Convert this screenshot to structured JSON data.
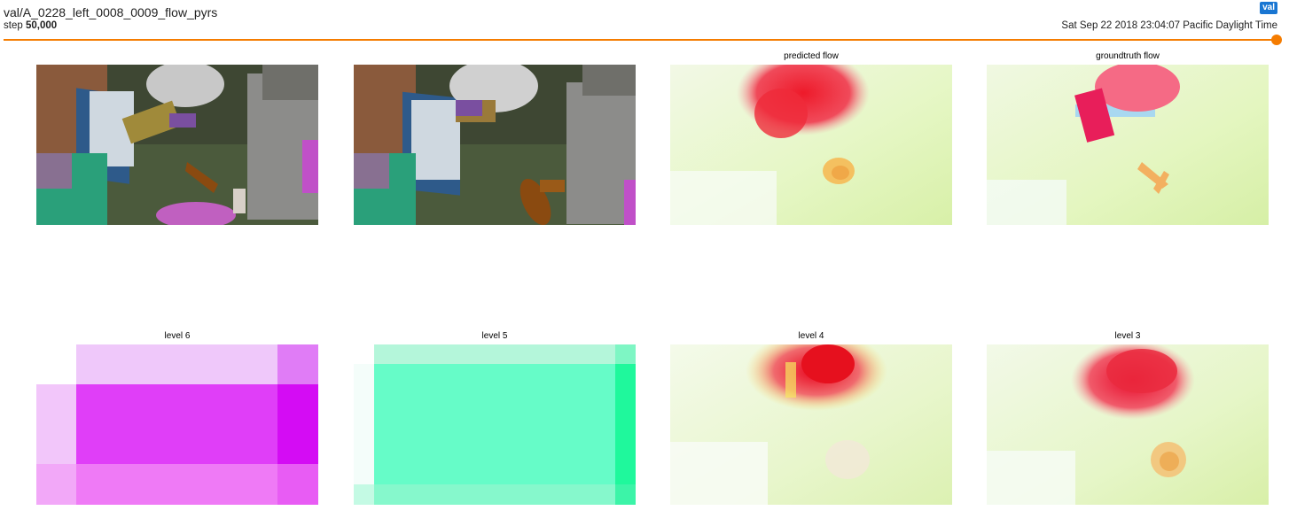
{
  "header": {
    "run_title": "val/A_0228_left_0008_0009_flow_pyrs",
    "step_prefix": "step",
    "step_value": "50,000",
    "tag": "val",
    "timestamp": "Sat Sep 22 2018 23:04:07 Pacific Daylight Time",
    "slider_progress": 1.0,
    "accent_color": "#f57c00",
    "tag_color": "#1976d2"
  },
  "panels_row1": [
    {
      "label": "",
      "content": "first input frame (3D scene)"
    },
    {
      "label": "",
      "content": "second input frame (3D scene)"
    },
    {
      "label": "predicted flow",
      "content": "flow visualization"
    },
    {
      "label": "groundtruth flow",
      "content": "flow visualization"
    }
  ],
  "panels_row2": [
    {
      "label": "level 6",
      "content": "coarse flow pyramid level"
    },
    {
      "label": "level 5",
      "content": "coarse flow pyramid level"
    },
    {
      "label": "level 4",
      "content": "flow pyramid level"
    },
    {
      "label": "level 3",
      "content": "flow pyramid level"
    }
  ]
}
